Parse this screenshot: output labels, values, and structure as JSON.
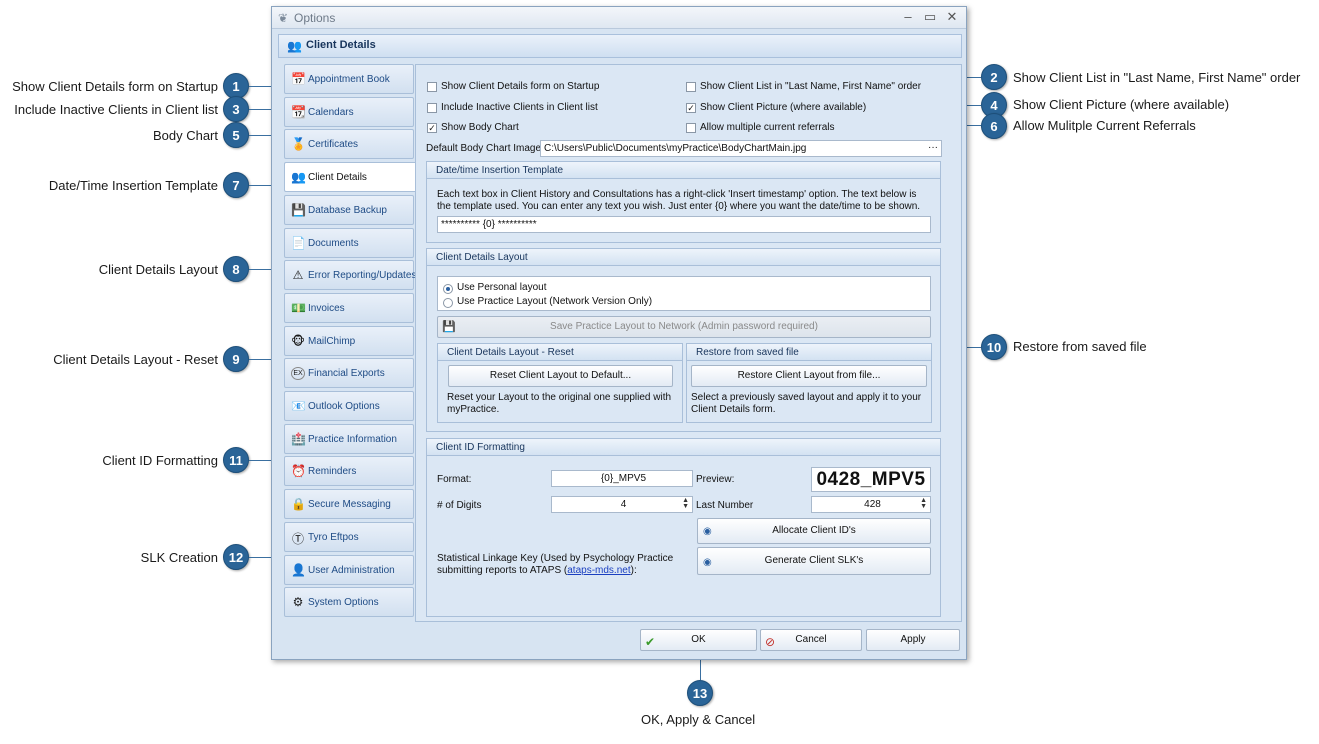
{
  "window": {
    "title": "Options",
    "controls": {
      "minimize": "–",
      "maximize": "▭",
      "close": "✕"
    },
    "header": "Client Details"
  },
  "tabs": [
    {
      "label": "Appointment Book",
      "icon": "calendar-book-icon",
      "glyph": "📅"
    },
    {
      "label": "Calendars",
      "icon": "calendar-icon",
      "glyph": "📆"
    },
    {
      "label": "Certificates",
      "icon": "certificate-icon",
      "glyph": "🏅"
    },
    {
      "label": "Client Details",
      "icon": "clients-icon",
      "glyph": "👥",
      "active": true
    },
    {
      "label": "Database Backup",
      "icon": "database-backup-icon",
      "glyph": "💾"
    },
    {
      "label": "Documents",
      "icon": "document-icon",
      "glyph": "📄"
    },
    {
      "label": "Error Reporting/Updates",
      "icon": "error-report-icon",
      "glyph": "⚠"
    },
    {
      "label": "Invoices",
      "icon": "invoice-icon",
      "glyph": "💵"
    },
    {
      "label": "MailChimp",
      "icon": "mailchimp-icon",
      "glyph": "🐵"
    },
    {
      "label": "Financial Exports",
      "icon": "export-icon",
      "glyph": "EX"
    },
    {
      "label": "Outlook Options",
      "icon": "outlook-icon",
      "glyph": "📧"
    },
    {
      "label": "Practice Information",
      "icon": "practice-icon",
      "glyph": "🏥"
    },
    {
      "label": "Reminders",
      "icon": "reminder-icon",
      "glyph": "⏰"
    },
    {
      "label": "Secure Messaging",
      "icon": "secure-message-icon",
      "glyph": "🔒"
    },
    {
      "label": "Tyro Eftpos",
      "icon": "tyro-icon",
      "glyph": "Ⓣ"
    },
    {
      "label": "User Administration",
      "icon": "user-admin-icon",
      "glyph": "👤"
    },
    {
      "label": "System Options",
      "icon": "system-options-icon",
      "glyph": "⚙"
    }
  ],
  "options": {
    "show_on_startup": {
      "label": "Show Client Details form on Startup",
      "checked": false
    },
    "include_inactive": {
      "label": "Include Inactive Clients in Client list",
      "checked": false
    },
    "show_body_chart": {
      "label": "Show Body Chart",
      "checked": true
    },
    "last_first_order": {
      "label": "Show Client List in \"Last Name, First Name\" order",
      "checked": false
    },
    "show_picture": {
      "label": "Show Client Picture (where available)",
      "checked": true
    },
    "multiple_referrals": {
      "label": "Allow multiple current referrals",
      "checked": false
    },
    "body_chart_label": "Default Body Chart Image",
    "body_chart_path": "C:\\Users\\Public\\Documents\\myPractice\\BodyChartMain.jpg",
    "browse": "···"
  },
  "datetime": {
    "title": "Date/time Insertion Template",
    "desc": "Each text box in Client History and Consultations has a right-click 'Insert timestamp' option.  The text below is the template used. You can enter any text you wish. Just enter {0} where you want the date/time to be shown.",
    "value": "********** {0} **********"
  },
  "layout": {
    "title": "Client Details Layout",
    "personal": "Use Personal layout",
    "practice": "Use Practice Layout (Network Version Only)",
    "save_button": "Save Practice Layout to Network (Admin password required)",
    "reset_title": "Client Details Layout - Reset",
    "reset_button": "Reset Client Layout to Default...",
    "reset_desc": "Reset your Layout to the original one supplied with myPractice.",
    "restore_title": "Restore from saved file",
    "restore_button": "Restore Client Layout from file...",
    "restore_desc": "Select a previously saved layout and apply it to your Client Details form."
  },
  "idformat": {
    "title": "Client ID Formatting",
    "format_label": "Format:",
    "format_value": "{0}_MPV5",
    "preview_label": "Preview:",
    "preview_value": "0428_MPV5",
    "digits_label": "# of Digits",
    "digits_value": "4",
    "last_label": "Last Number",
    "last_value": "428",
    "allocate_button": "Allocate Client ID's",
    "slk_desc_pre": "Statistical Linkage Key (Used by Psychology Practice submitting reports to ATAPS (",
    "slk_link": "ataps-mds.net",
    "slk_desc_post": "):",
    "generate_button": "Generate Client SLK's"
  },
  "buttons": {
    "ok": "OK",
    "cancel": "Cancel",
    "apply": "Apply"
  },
  "callouts": [
    {
      "n": "1",
      "text": "Show Client Details form on Startup"
    },
    {
      "n": "2",
      "text": "Show Client List in \"Last Name, First Name\" order"
    },
    {
      "n": "3",
      "text": "Include Inactive Clients in Client list"
    },
    {
      "n": "4",
      "text": "Show Client Picture (where available)"
    },
    {
      "n": "5",
      "text": "Body Chart"
    },
    {
      "n": "6",
      "text": "Allow Mulitple Current Referrals"
    },
    {
      "n": "7",
      "text": "Date/Time Insertion Template"
    },
    {
      "n": "8",
      "text": "Client Details Layout"
    },
    {
      "n": "9",
      "text": "Client Details Layout - Reset"
    },
    {
      "n": "10",
      "text": "Restore from saved file"
    },
    {
      "n": "11",
      "text": "Client ID Formatting"
    },
    {
      "n": "12",
      "text": "SLK Creation"
    },
    {
      "n": "13",
      "text": "OK, Apply & Cancel"
    }
  ],
  "colors": {
    "callout": "#2a6497",
    "accent": "#18355c",
    "panel": "#dbe7f4"
  }
}
